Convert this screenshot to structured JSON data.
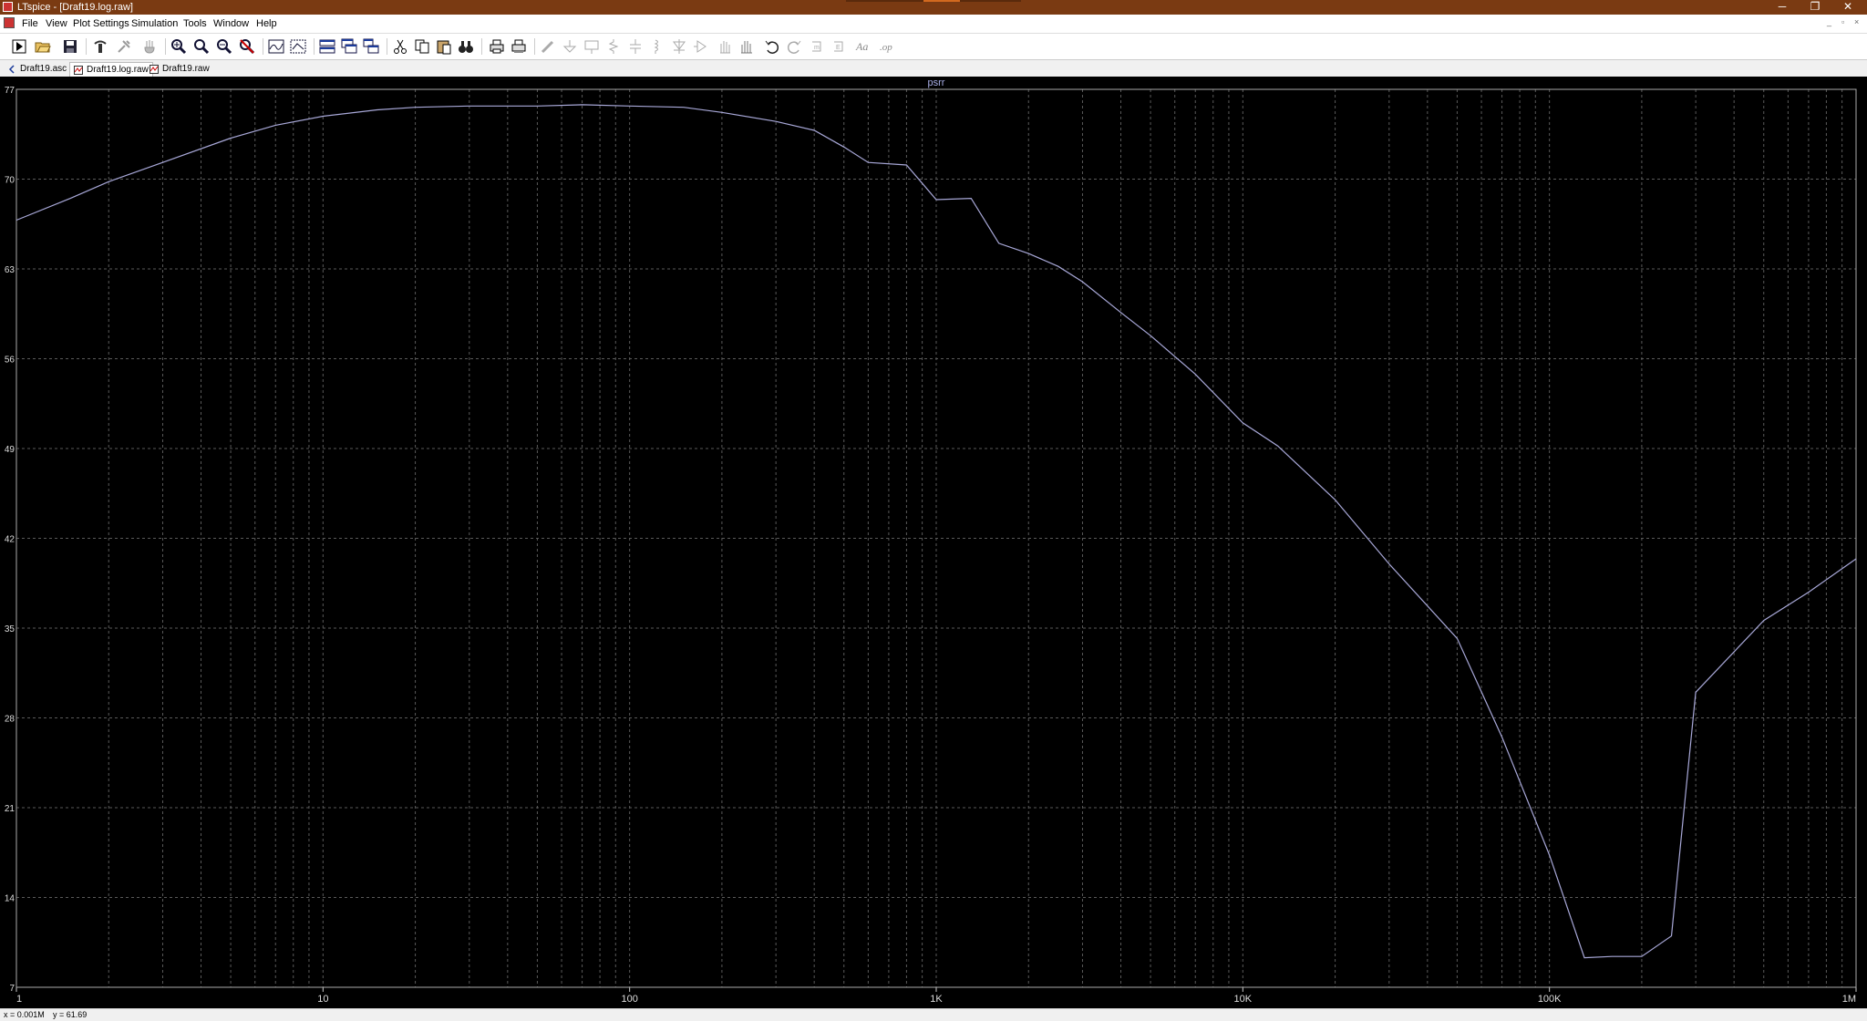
{
  "window": {
    "title": "LTspice - [Draft19.log.raw]",
    "minimize": "─",
    "maximize": "❐",
    "close": "✕"
  },
  "menu": {
    "items": [
      "File",
      "View",
      "Plot Settings",
      "Simulation",
      "Tools",
      "Window",
      "Help"
    ],
    "mdi_controls": [
      "_",
      "▫",
      "×"
    ]
  },
  "toolbar": {
    "buttons": [
      "run-icon",
      "open-icon",
      "save-icon",
      "control-panel-icon",
      "probe-icon",
      "halt-icon",
      "zoom-in-icon",
      "zoom-box-icon",
      "zoom-out-icon",
      "zoom-fit-icon",
      "autorange-icon",
      "zoom-full-icon",
      "tile-horizontal-icon",
      "cascade-icon",
      "tile-vertical-icon",
      "cut-icon",
      "copy-icon",
      "paste-icon",
      "find-icon",
      "print-icon",
      "print-preview-icon",
      "wire-icon",
      "ground-icon",
      "label-icon",
      "resistor-icon",
      "capacitor-icon",
      "inductor-icon",
      "diode-icon",
      "component-icon",
      "move-icon",
      "drag-icon",
      "undo-icon",
      "redo-icon",
      "rotate-icon",
      "mirror-icon",
      "text-icon",
      "spice-directive-icon"
    ]
  },
  "tabs": [
    {
      "label": "Draft19.asc",
      "icon": "schematic-icon"
    },
    {
      "label": "Draft19.log.raw",
      "icon": "waveform-icon",
      "active": true
    },
    {
      "label": "Draft19.raw",
      "icon": "waveform-icon"
    }
  ],
  "status": {
    "x_readout": "x = 0.001M",
    "y_readout": "y = 61.69"
  },
  "colors": {
    "background": "#000000",
    "grid": "#5a5a5a",
    "trace": "#a8a8d8",
    "title_bar": "#7a3a12"
  },
  "chart_data": {
    "type": "line",
    "title": "psrr",
    "xscale": "log",
    "xlim": [
      1,
      1000000
    ],
    "ylim": [
      7,
      77
    ],
    "x_ticks": [
      {
        "value": 1,
        "label": "1"
      },
      {
        "value": 10,
        "label": "10"
      },
      {
        "value": 100,
        "label": "100"
      },
      {
        "value": 1000,
        "label": "1K"
      },
      {
        "value": 10000,
        "label": "10K"
      },
      {
        "value": 100000,
        "label": "100K"
      },
      {
        "value": 1000000,
        "label": "1M"
      }
    ],
    "y_ticks": [
      77,
      70,
      63,
      56,
      49,
      42,
      35,
      28,
      21,
      14,
      7
    ],
    "grid": true,
    "series": [
      {
        "name": "psrr",
        "x": [
          1,
          1.5,
          2,
          3,
          5,
          7,
          10,
          15,
          20,
          30,
          50,
          70,
          100,
          150,
          200,
          300,
          400,
          500,
          600,
          800,
          1000,
          1300,
          1600,
          2000,
          2500,
          3000,
          4000,
          5000,
          7000,
          10000,
          13000,
          20000,
          30000,
          50000,
          70000,
          100000,
          130000,
          160000,
          200000,
          250000,
          300000,
          500000,
          700000,
          1000000
        ],
        "y": [
          66.8,
          68.5,
          69.8,
          71.3,
          73.2,
          74.2,
          74.9,
          75.4,
          75.6,
          75.7,
          75.7,
          75.8,
          75.7,
          75.6,
          75.2,
          74.5,
          73.8,
          72.5,
          71.3,
          71.1,
          68.4,
          68.5,
          65.0,
          64.2,
          63.2,
          62.0,
          59.6,
          57.8,
          54.8,
          51.0,
          49.2,
          45.0,
          40.0,
          34.2,
          26.5,
          17.3,
          9.3,
          9.4,
          9.4,
          11.0,
          30.0,
          35.6,
          37.8,
          40.4
        ]
      }
    ]
  }
}
